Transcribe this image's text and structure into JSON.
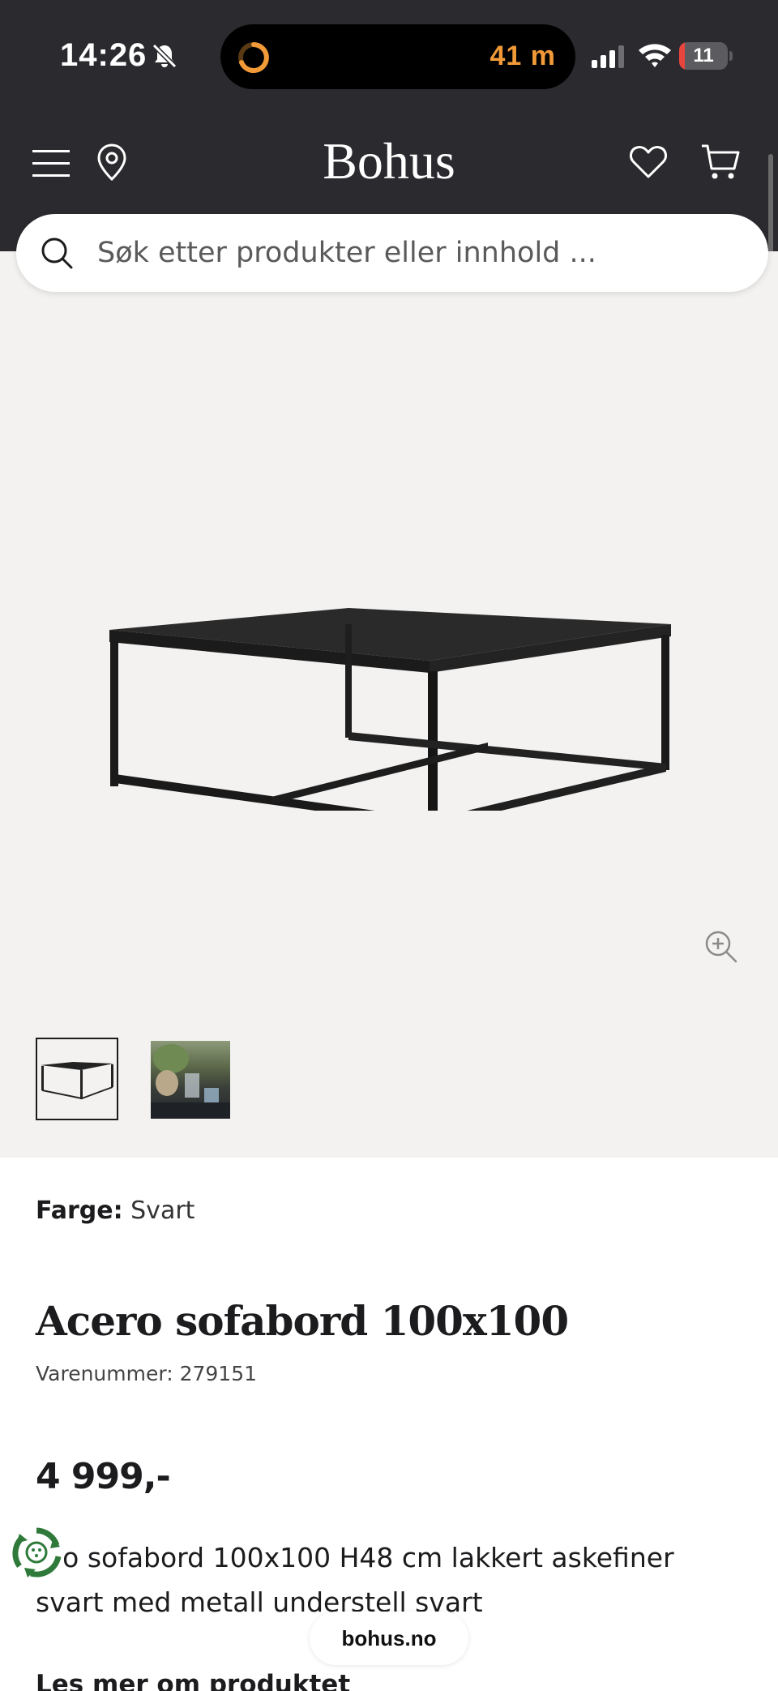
{
  "status_bar": {
    "time": "14:26",
    "live_activity_timer": "41 m",
    "battery_percent": "11",
    "battery_level": 0.11,
    "battery_color": "#e8453c",
    "accent_color": "#f29a38"
  },
  "header": {
    "logo": "Bohus",
    "icons": [
      "menu-icon",
      "location-pin-icon",
      "heart-icon",
      "cart-icon"
    ]
  },
  "search": {
    "placeholder": "Søk etter produkter eller innhold ..."
  },
  "gallery": {
    "thumbnails": [
      "thumbnail-table",
      "thumbnail-room"
    ],
    "selected_thumbnail": 0
  },
  "product": {
    "color_label": "Farge:",
    "color_value": "Svart",
    "title": "Acero sofabord 100x100",
    "sku": "Varenummer: 279151",
    "price": "4 999,-",
    "description": "ero sofabord 100x100 H48 cm lakkert askefiner svart med metall understell svart",
    "read_more": "Les mer om produktet"
  },
  "browser": {
    "url": "bohus.no"
  },
  "colors": {
    "header_bg": "#2b2b2f",
    "gallery_bg": "#f3f2f0",
    "text": "#1c1c1e"
  }
}
